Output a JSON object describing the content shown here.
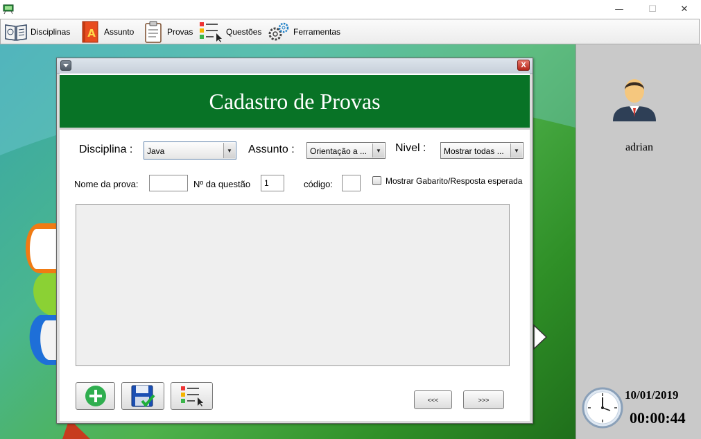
{
  "window": {
    "minimize": "—",
    "maximize": "☐",
    "close": "✕"
  },
  "menu": {
    "items": [
      {
        "label": "Disciplinas",
        "icon": "book-icon"
      },
      {
        "label": "Assunto",
        "icon": "notebook-a-icon"
      },
      {
        "label": "Provas",
        "icon": "clipboard-icon"
      },
      {
        "label": "Questões",
        "icon": "question-list-icon"
      },
      {
        "label": "Ferramentas",
        "icon": "gears-icon"
      }
    ]
  },
  "dialog": {
    "title": "Cadastro de Provas",
    "close_glyph": "X",
    "disciplina_label": "Disciplina :",
    "disciplina_value": "Java",
    "assunto_label": "Assunto :",
    "assunto_value": "Orientação a ...",
    "nivel_label": "Nivel :",
    "nivel_value": "Mostrar todas ...",
    "nome_prova_label": "Nome da prova:",
    "nome_prova_value": "",
    "num_questao_label": "Nº da questão",
    "num_questao_value": "1",
    "codigo_label": "código:",
    "codigo_value": "",
    "gabarito_label": "Mostrar Gabarito/Resposta esperada",
    "gabarito_checked": false,
    "prev_label": "<<<",
    "next_label": ">>>"
  },
  "side": {
    "username": "adrian",
    "date": "10/01/2019",
    "time": "00:00:44"
  },
  "colors": {
    "header_green": "#087326",
    "side_panel": "#c9c9c9",
    "add_green": "#2fae4f",
    "save_blue": "#1b4fb3"
  }
}
